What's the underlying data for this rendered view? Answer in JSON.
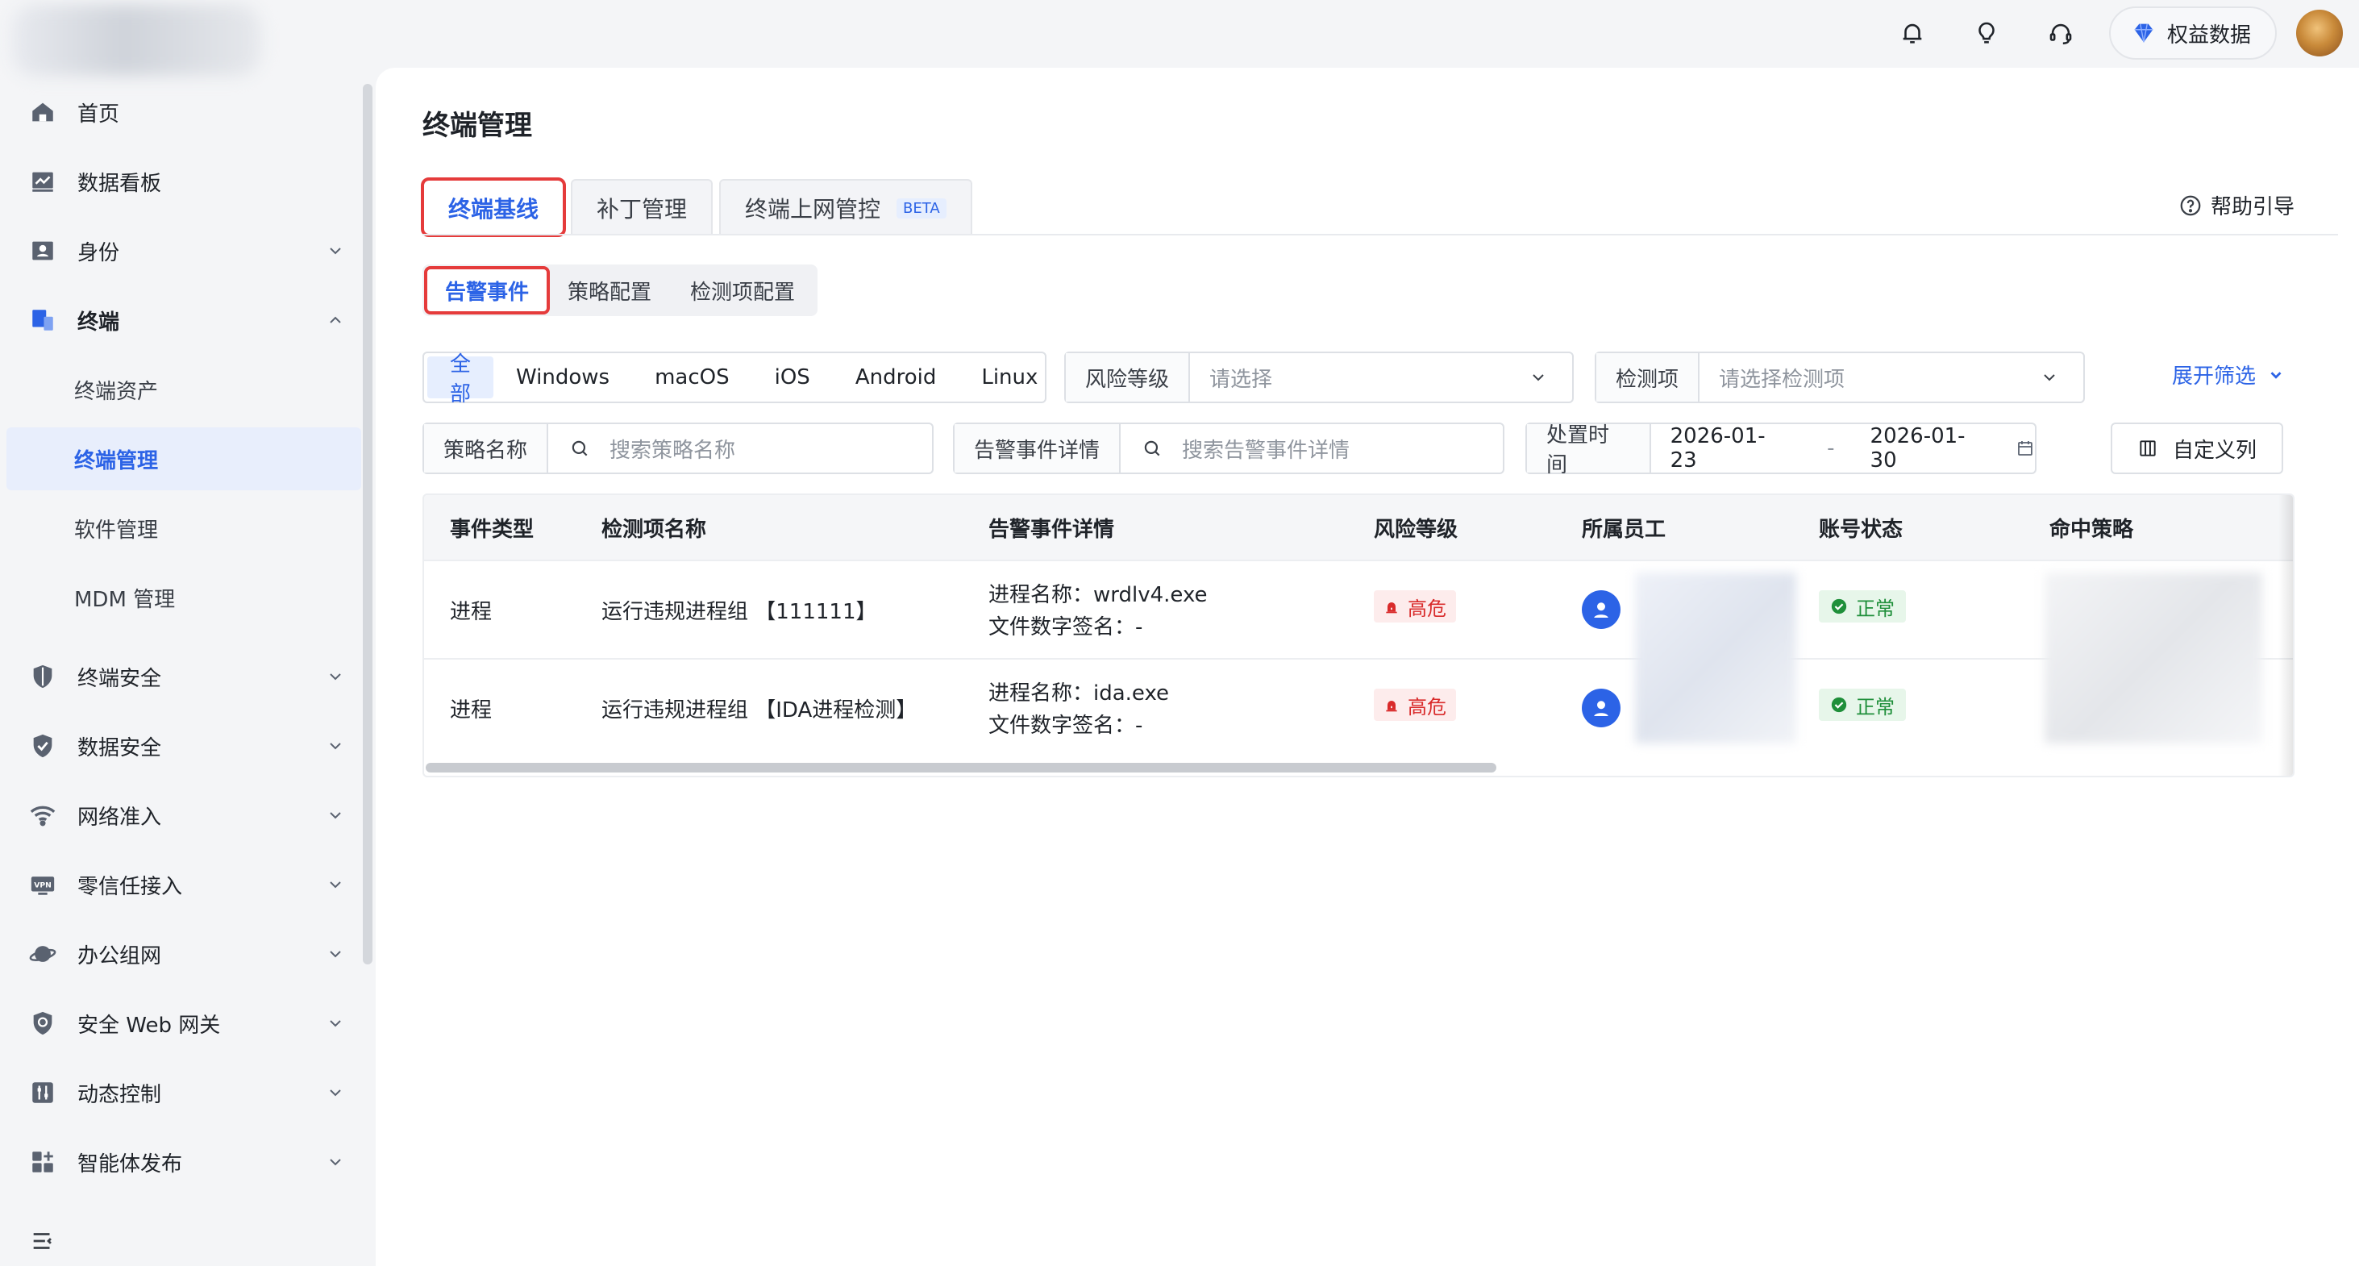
{
  "topbar": {
    "equity_label": "权益数据",
    "icons": [
      "bell-icon",
      "lightbulb-icon",
      "headset-icon",
      "diamond-icon"
    ],
    "colors": {
      "accent": "#2c63e6"
    }
  },
  "sidebar": {
    "items": [
      {
        "label": "首页",
        "icon": "home-icon"
      },
      {
        "label": "数据看板",
        "icon": "chart-board-icon"
      },
      {
        "label": "身份",
        "icon": "id-card-icon"
      },
      {
        "label": "终端",
        "icon": "devices-icon"
      },
      {
        "label": "终端安全",
        "icon": "shield-icon"
      },
      {
        "label": "数据安全",
        "icon": "shield-check-icon"
      },
      {
        "label": "网络准入",
        "icon": "wifi-icon"
      },
      {
        "label": "零信任接入",
        "icon": "vpn-icon"
      },
      {
        "label": "办公组网",
        "icon": "planet-icon"
      },
      {
        "label": "安全 Web 网关",
        "icon": "shield-web-icon"
      },
      {
        "label": "动态控制",
        "icon": "sliders-icon"
      },
      {
        "label": "智能体发布",
        "icon": "grid-plus-icon"
      }
    ],
    "sub_items": [
      {
        "label": "终端资产"
      },
      {
        "label": "终端管理"
      },
      {
        "label": "软件管理"
      },
      {
        "label": "MDM 管理"
      }
    ]
  },
  "main": {
    "title": "终端管理",
    "tabs": [
      {
        "label": "终端基线"
      },
      {
        "label": "补丁管理"
      },
      {
        "label": "终端上网管控",
        "badge": "BETA"
      }
    ],
    "help_label": "帮助引导",
    "subtabs": [
      {
        "label": "告警事件"
      },
      {
        "label": "策略配置"
      },
      {
        "label": "检测项配置"
      }
    ],
    "os_filter": [
      "全部",
      "Windows",
      "macOS",
      "iOS",
      "Android",
      "Linux"
    ],
    "filters": {
      "risk_label": "风险等级",
      "risk_placeholder": "请选择",
      "check_label": "检测项",
      "check_placeholder": "请选择检测项",
      "expand_label": "展开筛选",
      "policy_label": "策略名称",
      "policy_placeholder": "搜索策略名称",
      "detail_label": "告警事件详情",
      "detail_placeholder": "搜索告警事件详情",
      "time_label": "处置时间",
      "time_start": "2026-01-23",
      "time_sep": "-",
      "time_end": "2026-01-30",
      "columns_label": "自定义列"
    },
    "table": {
      "headers": [
        "事件类型",
        "检测项名称",
        "告警事件详情",
        "风险等级",
        "所属员工",
        "账号状态",
        "命中策略"
      ],
      "rows": [
        {
          "type": "进程",
          "check": "运行违规进程组 【111111】",
          "detail1": "进程名称：wrdlv4.exe",
          "detail2": "文件数字签名：-",
          "risk": "高危",
          "status": "正常"
        },
        {
          "type": "进程",
          "check": "运行违规进程组 【IDA进程检测】",
          "detail1": "进程名称：ida.exe",
          "detail2": "文件数字签名：-",
          "risk": "高危",
          "status": "正常"
        }
      ]
    }
  }
}
